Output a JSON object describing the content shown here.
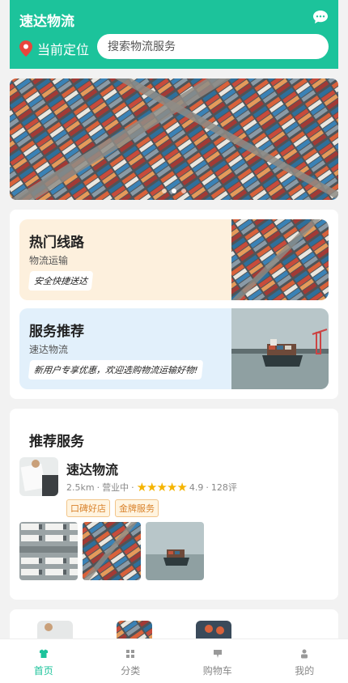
{
  "header": {
    "app_title": "速达物流",
    "location_label": "当前定位",
    "search_placeholder": "搜索物流服务"
  },
  "banner": {
    "dot_count": 3,
    "active_dot": 1
  },
  "promos": [
    {
      "title": "热门线路",
      "subtitle": "物流运输",
      "tag": "安全快捷送达",
      "bg": "#fdf0dd"
    },
    {
      "title": "服务推荐",
      "subtitle": "速达物流",
      "tag": "新用户专享优惠，欢迎选购物流运输好物!",
      "bg": "#e2f0fb"
    }
  ],
  "recommend": {
    "title": "推荐服务",
    "shop": {
      "name": "速达物流",
      "distance": "2.5km",
      "status": "营业中",
      "stars": "★★★★★",
      "rating": "4.9",
      "reviews": "128评",
      "tags": [
        "口碑好店",
        "金牌服务"
      ]
    }
  },
  "tabbar": [
    {
      "label": "首页",
      "icon": "shirt-icon",
      "active": true
    },
    {
      "label": "分类",
      "icon": "grid-icon",
      "active": false
    },
    {
      "label": "购物车",
      "icon": "cart-icon",
      "active": false
    },
    {
      "label": "我的",
      "icon": "user-icon",
      "active": false
    }
  ],
  "colors": {
    "accent": "#1cc39b",
    "star": "#f5b400",
    "tag": "#d9822b"
  }
}
